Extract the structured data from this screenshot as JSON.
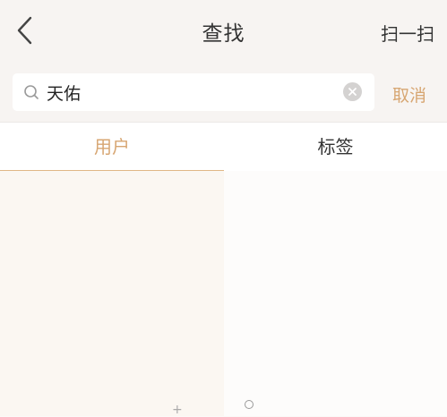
{
  "header": {
    "title": "查找",
    "scan_label": "扫一扫"
  },
  "search": {
    "value": "天佑",
    "cancel_label": "取消"
  },
  "tabs": [
    {
      "label": "用户",
      "active": true
    },
    {
      "label": "标签",
      "active": false
    }
  ],
  "colors": {
    "accent": "#d7a672",
    "header_bg": "#f7f4f2"
  }
}
